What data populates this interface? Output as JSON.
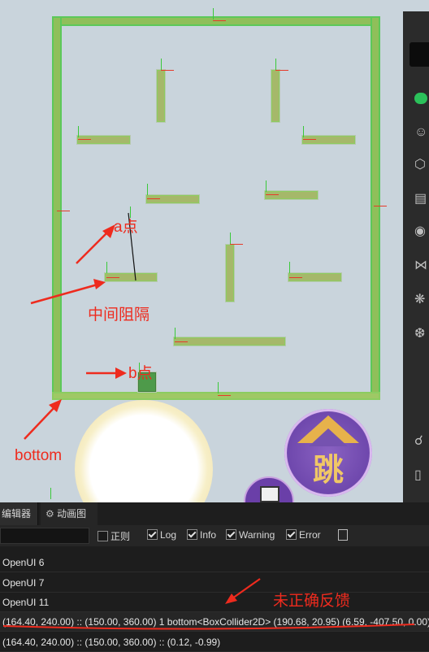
{
  "annotations": {
    "a_point": "a点",
    "middle_block": "中间阻隔",
    "b_point": "b点",
    "bottom": "bottom",
    "not_feedback": "未正确反馈"
  },
  "jump_button": {
    "glyph": "跳"
  },
  "tabs": {
    "editor": "编辑器",
    "animation": "动画图"
  },
  "filters": {
    "zhengze": {
      "label": "正则",
      "checked": false
    },
    "log": {
      "label": "Log",
      "checked": true
    },
    "info": {
      "label": "Info",
      "checked": true
    },
    "warning": {
      "label": "Warning",
      "checked": true
    },
    "error": {
      "label": "Error",
      "checked": true
    }
  },
  "logs": [
    "OpenUI 6",
    "OpenUI 7",
    "OpenUI 11",
    "(164.40, 240.00) :: (150.00, 360.00) 1 bottom<BoxCollider2D> (190.68, 20.95) (6.59, -407.50, 0.00)",
    "(164.40, 240.00) :: (150.00, 360.00) :: (0.12, -0.99)"
  ],
  "colors": {
    "annotation": "#ee2b1e",
    "wall": "#5cc85a",
    "console_bg": "#1d1d1d"
  },
  "icons": [
    "wechat-icon",
    "user-icon",
    "cube-icon",
    "folder-icon",
    "aperture-icon",
    "butterfly-icon",
    "atom-icon",
    "hex-icon",
    "link-icon",
    "phone-icon",
    "menu-icon"
  ]
}
